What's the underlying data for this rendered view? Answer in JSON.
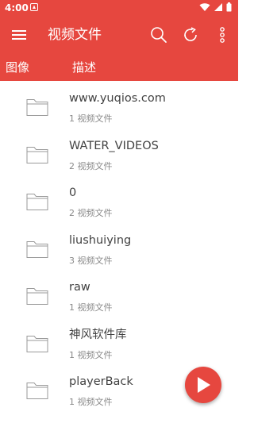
{
  "status_bar": {
    "time": "4:00"
  },
  "toolbar": {
    "title": "视频文件",
    "icons": [
      "menu-icon",
      "search-icon",
      "refresh-icon",
      "more-vert-icon"
    ]
  },
  "tabs": [
    {
      "label": "图像"
    },
    {
      "label": "描述"
    }
  ],
  "folders": [
    {
      "name": "www.yuqios.com",
      "count": "1 视频文件"
    },
    {
      "name": "WATER_VIDEOS",
      "count": "2 视频文件"
    },
    {
      "name": "0",
      "count": "2 视频文件"
    },
    {
      "name": "liushuiying",
      "count": "3 视频文件"
    },
    {
      "name": "raw",
      "count": "1 视频文件"
    },
    {
      "name": "神风软件库",
      "count": "1 视频文件"
    },
    {
      "name": "playerBack",
      "count": "1 视频文件"
    }
  ],
  "fab": {
    "icon": "play-icon"
  },
  "colors": {
    "primary": "#e6473f",
    "text": "#424242",
    "subtext": "#8a8a8a"
  }
}
